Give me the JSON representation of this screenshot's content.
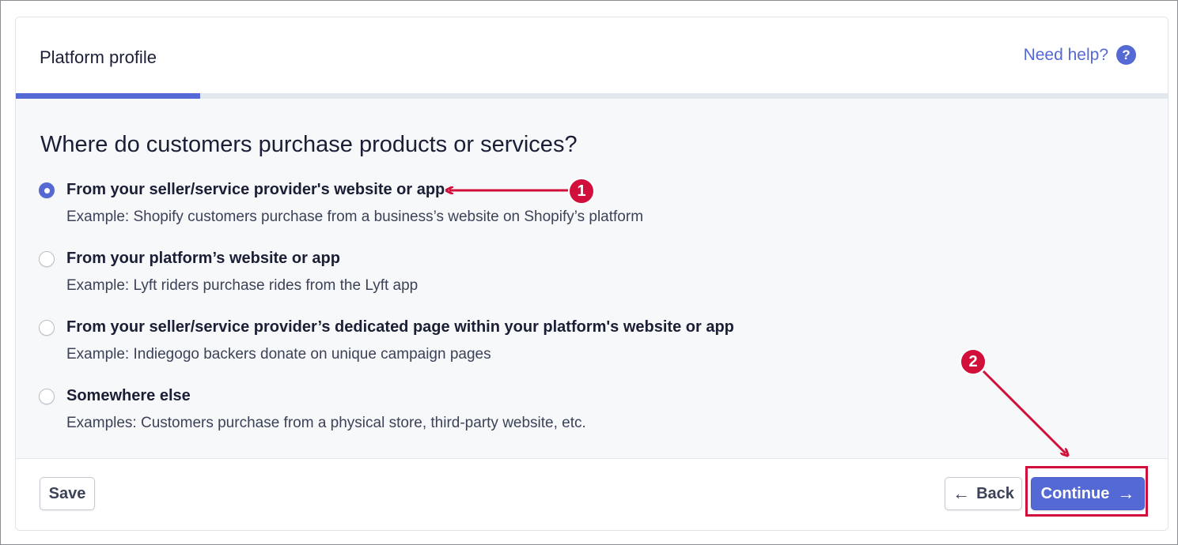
{
  "header": {
    "title": "Platform profile",
    "help_label": "Need help?",
    "help_icon": "?"
  },
  "progress": {
    "fraction": 0.16,
    "color": "#5469d4"
  },
  "question": "Where do customers purchase products or services?",
  "options": [
    {
      "label": "From your seller/service provider's website or app",
      "description": "Example: Shopify customers purchase from a business’s website on Shopify’s platform",
      "selected": true
    },
    {
      "label": "From your platform’s website or app",
      "description": "Example: Lyft riders purchase rides from the Lyft app",
      "selected": false
    },
    {
      "label": "From your seller/service provider’s dedicated page within your platform's website or app",
      "description": "Example: Indiegogo backers donate on unique campaign pages",
      "selected": false
    },
    {
      "label": "Somewhere else",
      "description": "Examples: Customers purchase from a physical store, third-party website, etc.",
      "selected": false
    }
  ],
  "footer": {
    "save_label": "Save",
    "back_label": "Back",
    "back_icon": "←",
    "continue_label": "Continue",
    "continue_icon": "→"
  },
  "annotations": {
    "badge1": "1",
    "badge2": "2",
    "color": "#d0103a"
  },
  "colors": {
    "accent": "#5469d4",
    "annotation": "#d0103a"
  }
}
